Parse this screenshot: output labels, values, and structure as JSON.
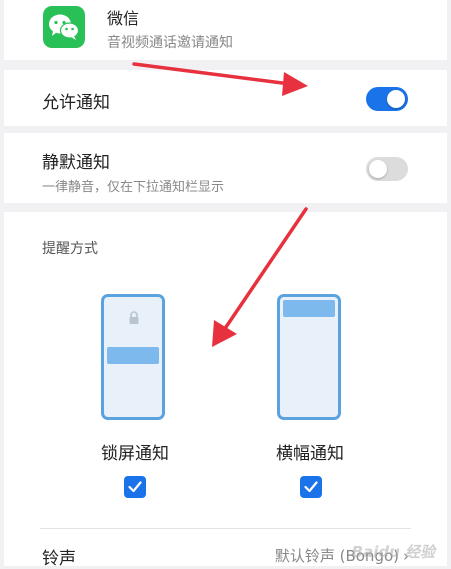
{
  "app": {
    "name": "微信",
    "subtitle": "音视频通话邀请通知",
    "icon": "wechat-icon"
  },
  "allow_notifications": {
    "label": "允许通知",
    "enabled": true
  },
  "silent_notifications": {
    "label": "静默通知",
    "description": "一律静音，仅在下拉通知栏显示",
    "enabled": false
  },
  "alert_style": {
    "title": "提醒方式",
    "options": [
      {
        "label": "锁屏通知",
        "checked": true,
        "icon": "lockscreen-phone-icon"
      },
      {
        "label": "横幅通知",
        "checked": true,
        "icon": "banner-phone-icon"
      }
    ]
  },
  "ringtone": {
    "label": "铃声",
    "value": "默认铃声 (Bongo)"
  },
  "colors": {
    "accent": "#1a73e8",
    "toggle_off": "#dcdcdc",
    "wechat_green": "#2ac058",
    "annotation_arrow": "#e8313f"
  },
  "watermark": "Baidu 经验"
}
